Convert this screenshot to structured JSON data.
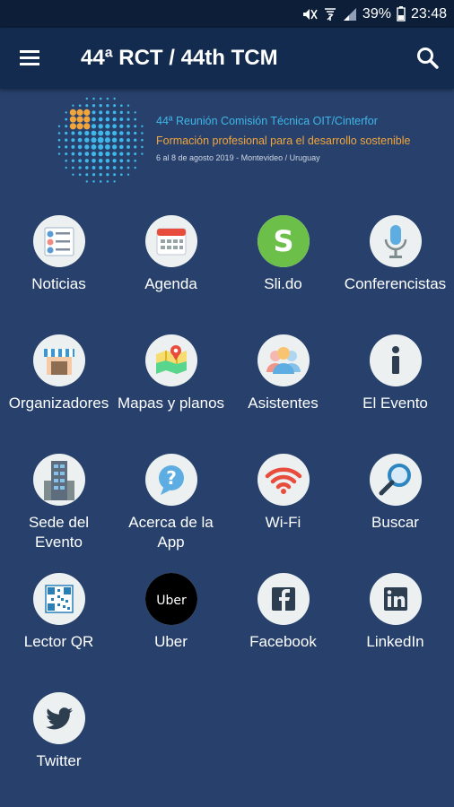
{
  "status_bar": {
    "battery": "39%",
    "time": "23:48"
  },
  "app_bar": {
    "title": "44ª RCT / 44th TCM"
  },
  "banner": {
    "line1": "44ª Reunión Comisión Técnica OIT/Cinterfor",
    "line2": "Formación profesional para el desarrollo sostenible",
    "line3": "6 al 8 de agosto 2019 - Montevideo / Uruguay"
  },
  "grid": [
    {
      "label": "Noticias",
      "icon": "news-icon"
    },
    {
      "label": "Agenda",
      "icon": "calendar-icon"
    },
    {
      "label": "Sli.do",
      "icon": "slido-icon"
    },
    {
      "label": "Conferencistas",
      "icon": "microphone-icon"
    },
    {
      "label": "Organizadores",
      "icon": "store-icon"
    },
    {
      "label": "Mapas y planos",
      "icon": "map-icon"
    },
    {
      "label": "Asistentes",
      "icon": "people-icon"
    },
    {
      "label": "El Evento",
      "icon": "info-icon"
    },
    {
      "label": "Sede del Evento",
      "icon": "building-icon"
    },
    {
      "label": "Acerca de la App",
      "icon": "question-chat-icon"
    },
    {
      "label": "Wi-Fi",
      "icon": "wifi-icon"
    },
    {
      "label": "Buscar",
      "icon": "magnifier-icon"
    },
    {
      "label": "Lector QR",
      "icon": "qr-code-icon"
    },
    {
      "label": "Uber",
      "icon": "uber-icon",
      "icon_text": "Uber"
    },
    {
      "label": "Facebook",
      "icon": "facebook-icon"
    },
    {
      "label": "LinkedIn",
      "icon": "linkedin-icon"
    },
    {
      "label": "Twitter",
      "icon": "twitter-icon"
    }
  ],
  "colors": {
    "background": "#27416c",
    "app_bar": "#122b4e",
    "status_bar": "#0c1e38",
    "banner_blue": "#3fb7e8",
    "banner_orange": "#f2a53c"
  }
}
